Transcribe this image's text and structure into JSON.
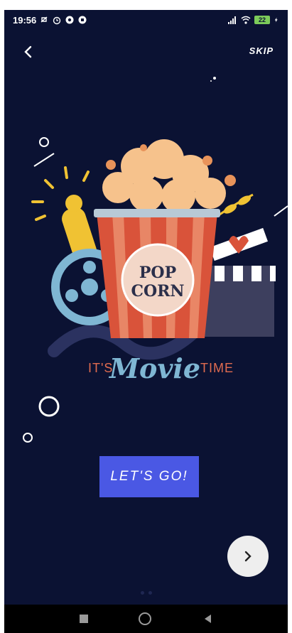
{
  "status_bar": {
    "time": "19:56",
    "battery": "22"
  },
  "top_bar": {
    "skip_label": "SKIP"
  },
  "illustration": {
    "popcorn_line1": "POP",
    "popcorn_line2": "CORN",
    "tagline_prefix": "IT'S",
    "tagline_script": "Movie",
    "tagline_suffix": "TIME"
  },
  "cta": {
    "label": "LET'S GO!"
  },
  "colors": {
    "background": "#0b1233",
    "accent": "#4a58e4",
    "popcorn_red": "#d9533a",
    "popcorn_cream": "#f6c28c",
    "reel_blue": "#7fb6d3",
    "trophy_yellow": "#f0c233"
  },
  "icons": [
    "back-chevron-icon",
    "next-chevron-icon",
    "wifi-icon",
    "signal-icon",
    "alarm-icon"
  ]
}
